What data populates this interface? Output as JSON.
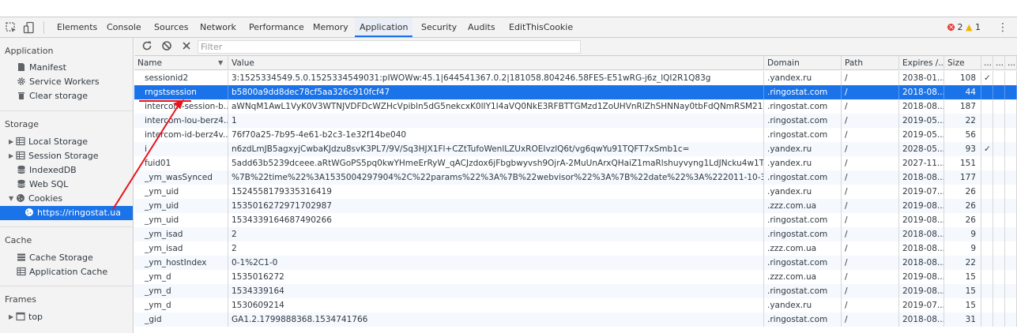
{
  "tabs": [
    {
      "label": "Elements",
      "active": false
    },
    {
      "label": "Console",
      "active": false
    },
    {
      "label": "Sources",
      "active": false
    },
    {
      "label": "Network",
      "active": false
    },
    {
      "label": "Performance",
      "active": false
    },
    {
      "label": "Memory",
      "active": false
    },
    {
      "label": "Application",
      "active": true
    },
    {
      "label": "Security",
      "active": false
    },
    {
      "label": "Audits",
      "active": false
    },
    {
      "label": "EditThisCookie",
      "active": false
    }
  ],
  "status": {
    "errors": "2",
    "warnings": "1"
  },
  "sidebar": {
    "application": {
      "title": "Application",
      "items": [
        "Manifest",
        "Service Workers",
        "Clear storage"
      ]
    },
    "storage": {
      "title": "Storage",
      "items": [
        "Local Storage",
        "Session Storage",
        "IndexedDB",
        "Web SQL",
        "Cookies",
        "https://ringostat.ua"
      ]
    },
    "cache": {
      "title": "Cache",
      "items": [
        "Cache Storage",
        "Application Cache"
      ]
    },
    "frames": {
      "title": "Frames",
      "items": [
        "top"
      ]
    }
  },
  "toolbar": {
    "filter_placeholder": "Filter"
  },
  "columns": {
    "name": "Name",
    "value": "Value",
    "domain": "Domain",
    "path": "Path",
    "expires": "Expires /...",
    "size": "Size",
    "e1": "...",
    "e2": "...",
    "e3": "..."
  },
  "cookies": [
    {
      "name": "sessionid2",
      "value": "3:1525334549.5.0.1525334549031:pIWOWw:45.1|644541367.0.2|181058.804246.58FES-E51wRG-j6z_lQI2R1Q83g",
      "domain": ".yandex.ru",
      "path": "/",
      "expires": "2038-01...",
      "size": "108",
      "e1": "✓",
      "e2": "",
      "e3": ""
    },
    {
      "name": "rngstsession",
      "value": "b5800a9dd8dec78cf5aa326c910fcf47",
      "domain": ".ringostat.com",
      "path": "/",
      "expires": "2018-08...",
      "size": "44",
      "e1": "",
      "e2": "",
      "e3": ""
    },
    {
      "name": "intercom-session-b...",
      "value": "aWNqM1AwL1VyK0V3WTNJVDFDcWZHcVpibln5dG5nekcxK0lIY1I4aVQ0NkE3RFBTTGMzd1ZoUHVnRlZhSHNNay0tbFdQNmRSM21KSkc2cU...",
      "domain": ".ringostat.com",
      "path": "/",
      "expires": "2018-08...",
      "size": "187",
      "e1": "",
      "e2": "",
      "e3": ""
    },
    {
      "name": "intercom-lou-berz4...",
      "value": "1",
      "domain": ".ringostat.com",
      "path": "/",
      "expires": "2019-05...",
      "size": "22",
      "e1": "",
      "e2": "",
      "e3": ""
    },
    {
      "name": "intercom-id-berz4v...",
      "value": "76f70a25-7b95-4e61-b2c3-1e32f14be040",
      "domain": ".ringostat.com",
      "path": "/",
      "expires": "2019-05...",
      "size": "56",
      "e1": "",
      "e2": "",
      "e3": ""
    },
    {
      "name": "i",
      "value": "n6zdLmJB5agxyjCwbaKJdzu8svK3PL7/9V/Sq3HJX1Fl+CZtTufoWenlLZUxROEIvzlQ6t/vg6qwYu91TQFT7xSmb1c=",
      "domain": ".yandex.ru",
      "path": "/",
      "expires": "2028-05...",
      "size": "93",
      "e1": "✓",
      "e2": "",
      "e3": ""
    },
    {
      "name": "fuid01",
      "value": "5add63b5239dceee.aRtWGoPS5pq0kwYHmeErRyW_qACJzdox6jFbgbwyvsh9OjrA-2MuUnArxQHaiZ1maRlshuyvyng1LdJNcku4w1TuI58pKm...",
      "domain": ".yandex.ru",
      "path": "/",
      "expires": "2027-11...",
      "size": "151",
      "e1": "",
      "e2": "",
      "e3": ""
    },
    {
      "name": "_ym_wasSynced",
      "value": "%7B%22time%22%3A1535004297904%2C%22params%22%3A%7B%22webvisor%22%3A%7B%22date%22%3A%222011-10-31%2016%3A...",
      "domain": ".ringostat.com",
      "path": "/",
      "expires": "2018-08...",
      "size": "177",
      "e1": "",
      "e2": "",
      "e3": ""
    },
    {
      "name": "_ym_uid",
      "value": "1524558179335316419",
      "domain": ".yandex.ru",
      "path": "/",
      "expires": "2019-07...",
      "size": "26",
      "e1": "",
      "e2": "",
      "e3": ""
    },
    {
      "name": "_ym_uid",
      "value": "1535016272971702987",
      "domain": ".zzz.com.ua",
      "path": "/",
      "expires": "2019-08...",
      "size": "26",
      "e1": "",
      "e2": "",
      "e3": ""
    },
    {
      "name": "_ym_uid",
      "value": "1534339164687490266",
      "domain": ".ringostat.com",
      "path": "/",
      "expires": "2019-08...",
      "size": "26",
      "e1": "",
      "e2": "",
      "e3": ""
    },
    {
      "name": "_ym_isad",
      "value": "2",
      "domain": ".ringostat.com",
      "path": "/",
      "expires": "2018-08...",
      "size": "9",
      "e1": "",
      "e2": "",
      "e3": ""
    },
    {
      "name": "_ym_isad",
      "value": "2",
      "domain": ".zzz.com.ua",
      "path": "/",
      "expires": "2018-08...",
      "size": "9",
      "e1": "",
      "e2": "",
      "e3": ""
    },
    {
      "name": "_ym_hostIndex",
      "value": "0-1%2C1-0",
      "domain": ".ringostat.com",
      "path": "/",
      "expires": "2018-08...",
      "size": "22",
      "e1": "",
      "e2": "",
      "e3": ""
    },
    {
      "name": "_ym_d",
      "value": "1535016272",
      "domain": ".zzz.com.ua",
      "path": "/",
      "expires": "2019-08...",
      "size": "15",
      "e1": "",
      "e2": "",
      "e3": ""
    },
    {
      "name": "_ym_d",
      "value": "1534339164",
      "domain": ".ringostat.com",
      "path": "/",
      "expires": "2019-08...",
      "size": "15",
      "e1": "",
      "e2": "",
      "e3": ""
    },
    {
      "name": "_ym_d",
      "value": "1530609214",
      "domain": ".yandex.ru",
      "path": "/",
      "expires": "2019-07...",
      "size": "15",
      "e1": "",
      "e2": "",
      "e3": ""
    },
    {
      "name": "_gid",
      "value": "GA1.2.1799888368.1534741766",
      "domain": ".ringostat.com",
      "path": "/",
      "expires": "2018-08...",
      "size": "31",
      "e1": "",
      "e2": "",
      "e3": ""
    }
  ],
  "colors": {
    "accent": "#1a73e8",
    "annotation_arrow": "#e8141b",
    "error": "#e53935",
    "warning": "#f0b400"
  },
  "selected_cookie_index": 1
}
